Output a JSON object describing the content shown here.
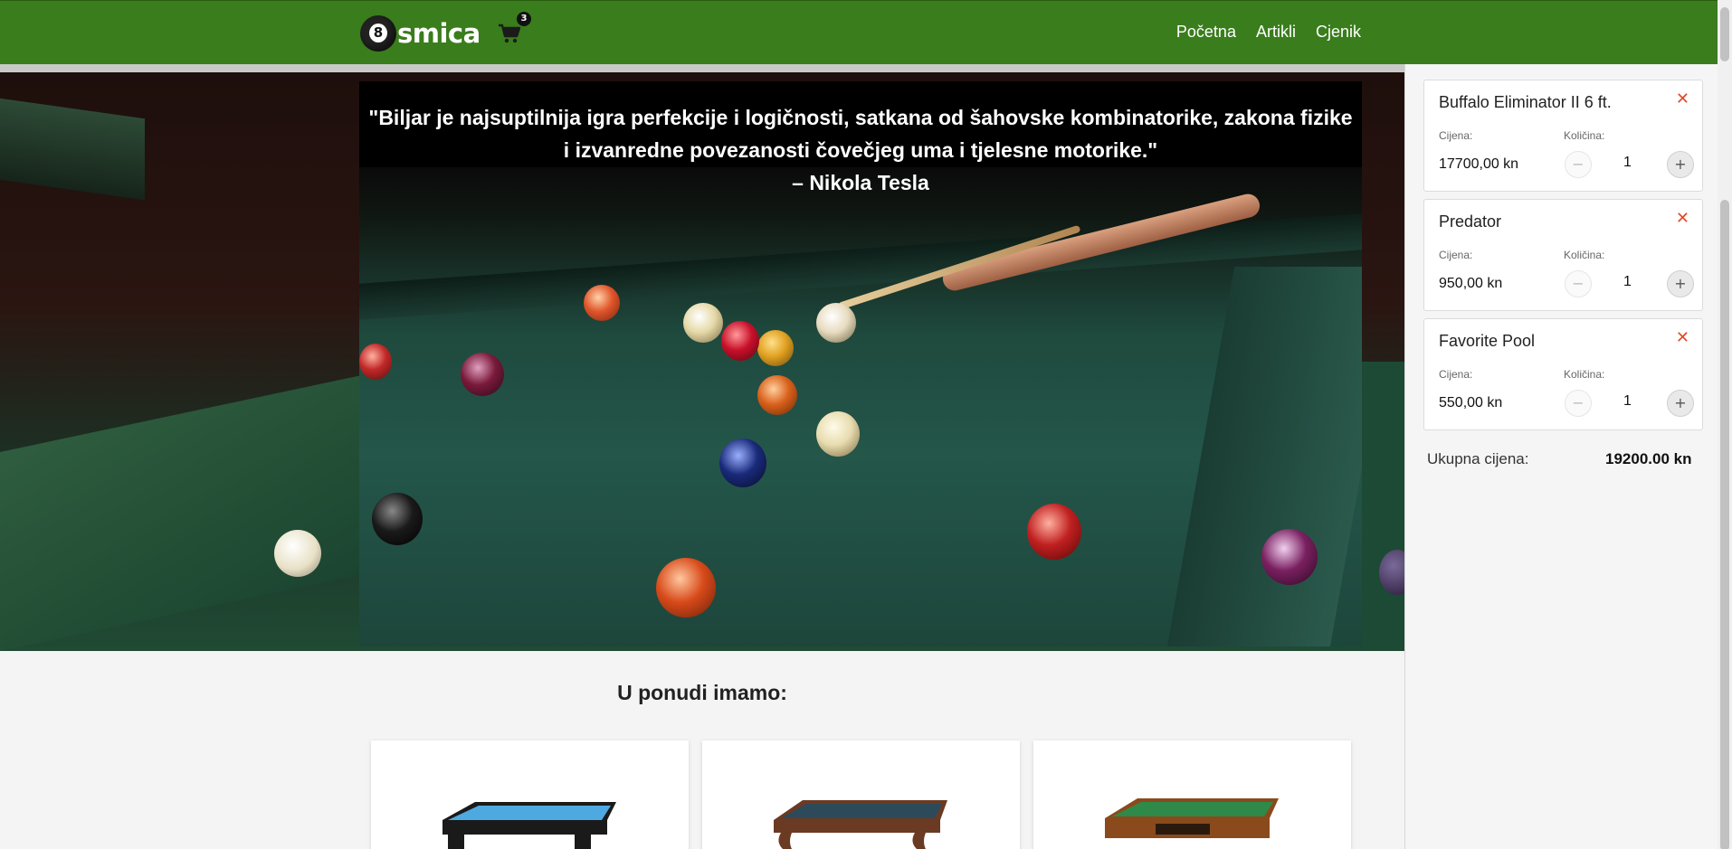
{
  "header": {
    "logo_digit": "8",
    "logo_text": "smica",
    "cart_count": "3",
    "nav": [
      "Početna",
      "Artikli",
      "Cjenik"
    ]
  },
  "hero": {
    "quote": "\"Biljar je najsuptilnija igra perfekcije i logičnosti, satkana od šahovske kombinatorike, zakona fizike i izvanredne povezanosti čovečjeg uma i tjelesne motorike.\"",
    "author": "– Nikola Tesla"
  },
  "offer": {
    "title": "U ponudi imamo:",
    "products": [
      {
        "felt_color": "#4ea9e0",
        "frame_color": "#1a1a1a"
      },
      {
        "felt_color": "#2c4a5a",
        "frame_color": "#6b3a22"
      },
      {
        "felt_color": "#2f8a4a",
        "frame_color": "#8a4a1c"
      }
    ]
  },
  "cart": {
    "price_label": "Cijena:",
    "qty_label": "Količina:",
    "minus_symbol": "−",
    "plus_symbol": "+",
    "remove_symbol": "✕",
    "items": [
      {
        "name": "Buffalo Eliminator II 6 ft.",
        "price": "17700,00 kn",
        "qty": "1"
      },
      {
        "name": "Predator",
        "price": "950,00 kn",
        "qty": "1"
      },
      {
        "name": "Favorite Pool",
        "price": "550,00 kn",
        "qty": "1"
      }
    ],
    "total_label": "Ukupna cijena:",
    "total_value": "19200.00 kn"
  },
  "colors": {
    "header_green": "#3a7d1c",
    "remove_red": "#e04a2a"
  }
}
